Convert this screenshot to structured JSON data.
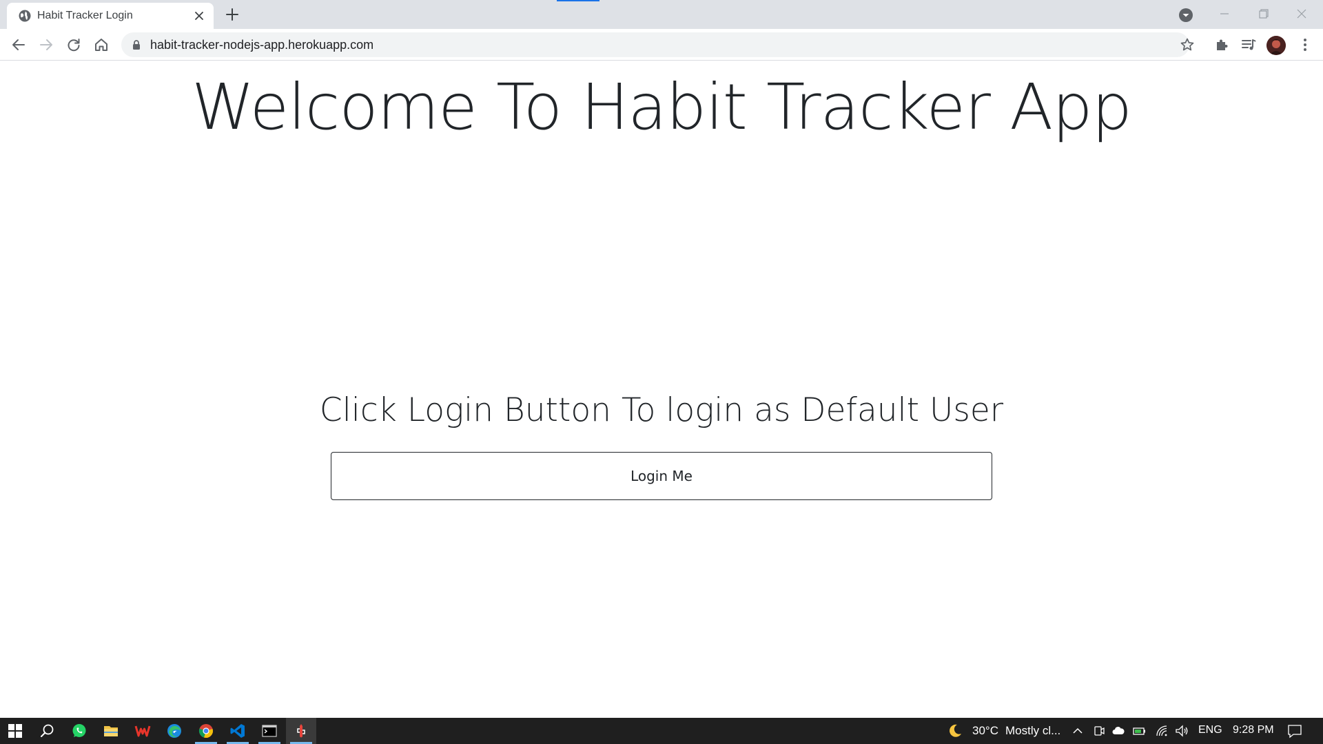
{
  "browser": {
    "tab": {
      "title": "Habit Tracker Login"
    },
    "address_bar": {
      "url": "habit-tracker-nodejs-app.herokuapp.com"
    }
  },
  "page": {
    "heading": "Welcome To Habit Tracker App",
    "instruction": "Click Login Button To login as Default User",
    "login_button_label": "Login Me"
  },
  "taskbar": {
    "pinned_apps": [
      "windows-start",
      "search",
      "whatsapp",
      "file-explorer",
      "wps-office",
      "edge",
      "chrome",
      "vscode",
      "terminal",
      "git-app"
    ],
    "weather": {
      "temperature": "30°C",
      "condition": "Mostly cl..."
    },
    "language": "ENG",
    "time": "9:28 PM"
  },
  "colors": {
    "tabstrip_bg": "#dee1e6",
    "omnibox_bg": "#f1f3f4",
    "page_text": "#212529",
    "taskbar_bg": "#1f1f1f",
    "accent": "#1a73e8"
  }
}
